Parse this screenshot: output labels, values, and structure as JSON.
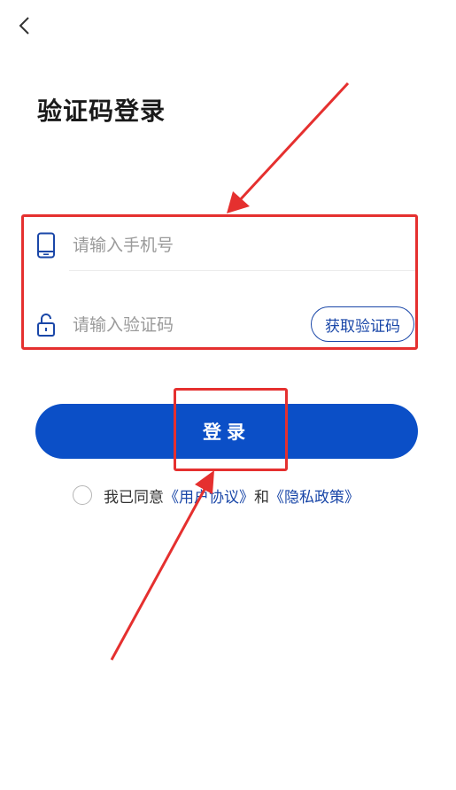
{
  "header": {
    "back_icon": "chevron-left-icon",
    "title": "验证码登录"
  },
  "form": {
    "phone": {
      "icon": "mobile-phone-icon",
      "placeholder": "请输入手机号",
      "value": ""
    },
    "code": {
      "icon": "unlock-icon",
      "placeholder": "请输入验证码",
      "value": "",
      "get_code_label": "获取验证码"
    },
    "login_label": "登录"
  },
  "agreement": {
    "checked": false,
    "prefix": "我已同意",
    "user_agreement": "《用户协议》",
    "conjunction": "和",
    "privacy_policy": "《隐私政策》"
  },
  "annotations": {
    "color": "#e5302f"
  },
  "colors": {
    "primary": "#0b4fc7",
    "link": "#1a47a8"
  }
}
